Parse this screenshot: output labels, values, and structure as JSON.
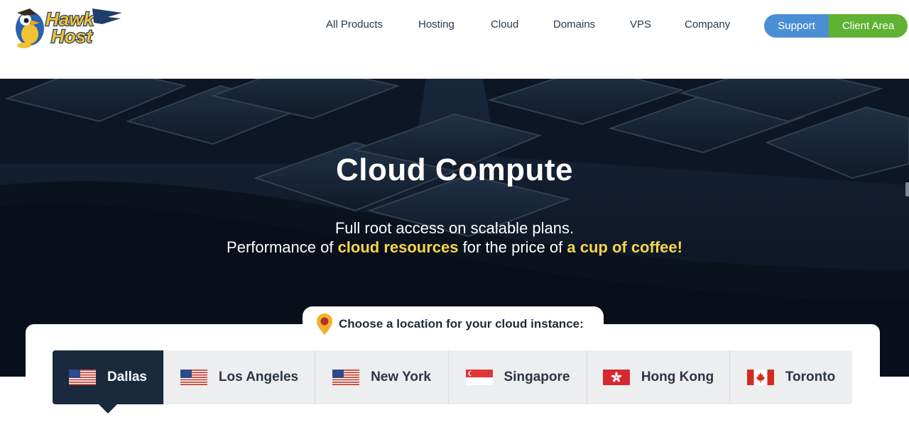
{
  "header": {
    "logo_text": [
      "Hawk",
      "Host"
    ],
    "nav": [
      "All Products",
      "Hosting",
      "Cloud",
      "Domains",
      "VPS",
      "Company"
    ],
    "support_label": "Support",
    "client_area_label": "Client Area"
  },
  "hero": {
    "title": "Cloud Compute",
    "subtitle_line1": "Full root access on scalable plans.",
    "subtitle_line2_a": "Performance of ",
    "subtitle_line2_b": "cloud resources",
    "subtitle_line2_c": " for the price of ",
    "subtitle_line2_d": "a cup of coffee!"
  },
  "locations": {
    "prompt": "Choose a location for your cloud instance:",
    "icon": "location-pin-icon",
    "selected": "Dallas",
    "items": [
      {
        "label": "Dallas",
        "flag": "us-flag-icon"
      },
      {
        "label": "Los Angeles",
        "flag": "us-flag-icon"
      },
      {
        "label": "New York",
        "flag": "us-flag-icon"
      },
      {
        "label": "Singapore",
        "flag": "singapore-flag-icon"
      },
      {
        "label": "Hong Kong",
        "flag": "hong-kong-flag-icon"
      },
      {
        "label": "Toronto",
        "flag": "canada-flag-icon"
      }
    ]
  },
  "colors": {
    "support": "#4a8fd4",
    "client_area": "#5fb233",
    "highlight": "#f7d54a",
    "active_tab": "#1a2a3d",
    "hero_bg": "#0c1524"
  }
}
